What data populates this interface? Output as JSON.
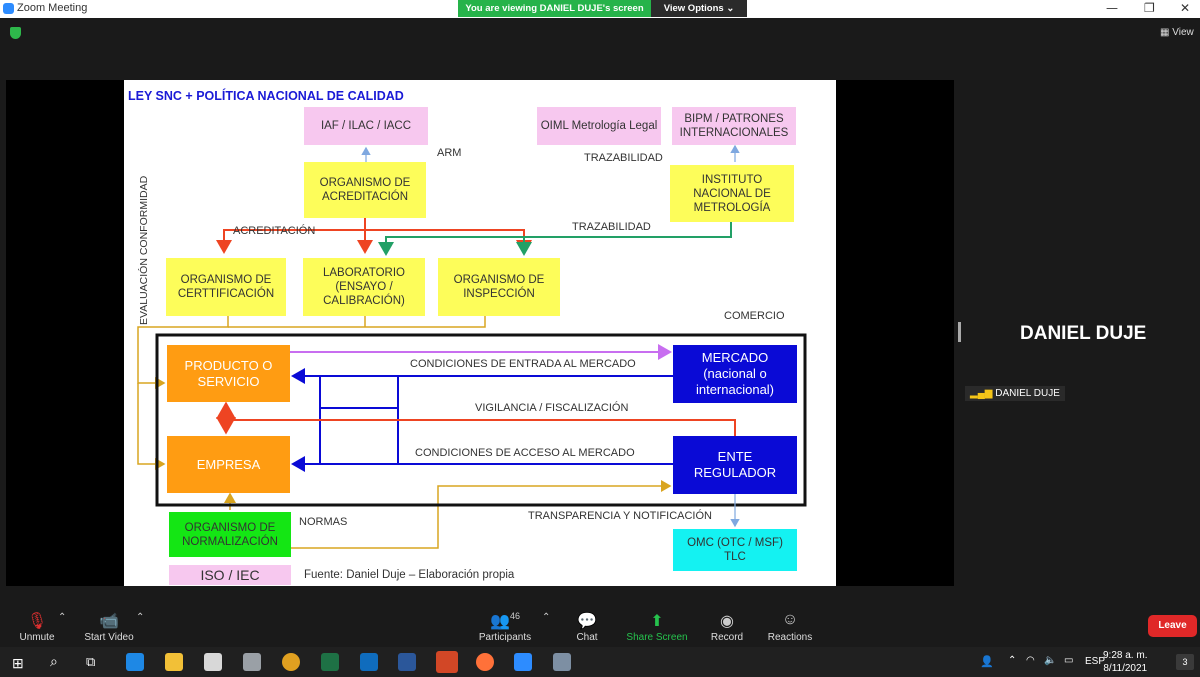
{
  "window": {
    "title": "Zoom Meeting",
    "min": "—",
    "max": "❐",
    "close": "✕"
  },
  "share_banner": {
    "viewing": "You are viewing DANIEL DUJE's screen",
    "view_options": "View Options ⌄"
  },
  "top_right": {
    "view": "View"
  },
  "slide": {
    "title": "LEY SNC + POLÍTICA NACIONAL DE CALIDAD",
    "vertical_label": "EVALUACIÓN CONFORMIDAD",
    "boxes": {
      "iaf": "IAF / ILAC / IACC",
      "oiml": "OIML Metrología Legal",
      "bipm": "BIPM / PATRONES INTERNACIONALES",
      "acred": "ORGANISMO DE ACREDITACIÓN",
      "inm": "INSTITUTO NACIONAL DE METROLOGÍA",
      "cert": "ORGANISMO DE CERTTIFICACIÓN",
      "lab": "LABORATORIO (ENSAYO / CALIBRACIÓN)",
      "insp": "ORGANISMO DE INSPECCIÓN",
      "producto": "PRODUCTO O SERVICIO",
      "empresa": "EMPRESA",
      "mercado": "MERCADO (nacional o internacional)",
      "ente": "ENTE REGULADOR",
      "normal": "ORGANISMO DE NORMALIZACIÓN",
      "omc": "OMC (OTC / MSF) TLC",
      "iso": "ISO / IEC"
    },
    "labels": {
      "arm": "ARM",
      "traz1": "TRAZABILIDAD",
      "acreditacion": "ACREDITACIÓN",
      "traz2": "TRAZABILIDAD",
      "comercio": "COMERCIO",
      "entrada": "CONDICIONES DE ENTRADA AL MERCADO",
      "vigilancia": "VIGILANCIA / FISCALIZACIÓN",
      "acceso": "CONDICIONES DE ACCESO AL MERCADO",
      "transparencia": "TRANSPARENCIA Y NOTIFICACIÓN",
      "normas": "NORMAS",
      "fuente": "Fuente: Daniel Duje – Elaboración propia"
    }
  },
  "participant": {
    "name": "DANIEL DUJE",
    "tag": "DANIEL DUJE"
  },
  "toolbar": {
    "unmute": "Unmute",
    "start_video": "Start Video",
    "participants": "Participants",
    "participant_count": "46",
    "chat": "Chat",
    "share_screen": "Share Screen",
    "record": "Record",
    "reactions": "Reactions",
    "leave": "Leave"
  },
  "taskbar": {
    "lang": "ESP",
    "time": "9:28 a. m.",
    "date": "8/11/2021",
    "notif": "3"
  },
  "colors": {
    "accent_green": "#26b34a",
    "leave_red": "#e02828"
  }
}
